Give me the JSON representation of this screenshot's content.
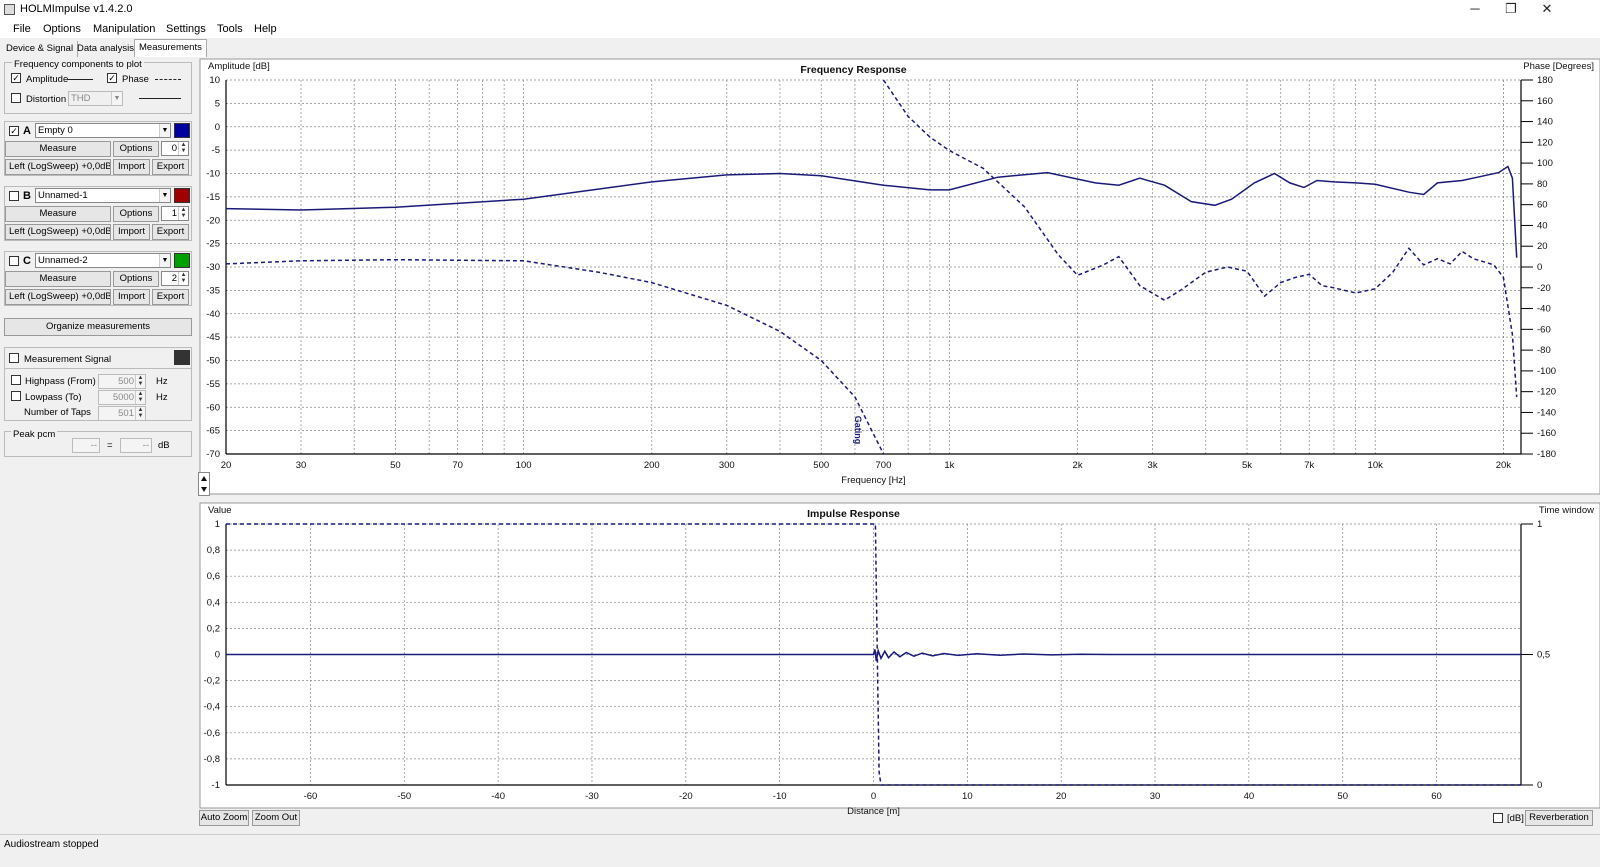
{
  "window": {
    "title": "HOLMImpulse v1.4.2.0",
    "minimize": "─",
    "restore": "❐",
    "close": "✕"
  },
  "menu": [
    "File",
    "Options",
    "Manipulation",
    "Settings",
    "Tools",
    "Help"
  ],
  "tabs": [
    "Device & Signal",
    "Data analysis",
    "Measurements"
  ],
  "freq_components": {
    "title": "Frequency components to plot",
    "amplitude": {
      "label": "Amplitude",
      "checked": true
    },
    "phase": {
      "label": "Phase",
      "checked": true
    },
    "distortion": {
      "label": "Distortion",
      "checked": false,
      "mode": "THD"
    }
  },
  "measurements": [
    {
      "letter": "A",
      "checked": true,
      "name": "Empty 0",
      "color": "#0000a0",
      "index": "0",
      "source": "Left (LogSweep) +0,0dB"
    },
    {
      "letter": "B",
      "checked": false,
      "name": "Unnamed-1",
      "color": "#a00000",
      "index": "1",
      "source": "Left (LogSweep) +0,0dB"
    },
    {
      "letter": "C",
      "checked": false,
      "name": "Unnamed-2",
      "color": "#00a000",
      "index": "2",
      "source": "Left (LogSweep) +0,0dB"
    }
  ],
  "buttons": {
    "measure": "Measure",
    "options": "Options",
    "import": "Import",
    "export": "Export",
    "organize": "Organize measurements",
    "auto_zoom": "Auto Zoom",
    "zoom_out": "Zoom Out",
    "reverberation": "Reverberation"
  },
  "measurement_signal": {
    "label": "Measurement Signal",
    "checked": false,
    "color": "#333333"
  },
  "filters": {
    "highpass": {
      "label": "Highpass (From)",
      "value": "500",
      "unit": "Hz"
    },
    "lowpass": {
      "label": "Lowpass (To)",
      "value": "5000",
      "unit": "Hz"
    },
    "taps": {
      "label": "Number of Taps",
      "value": "501"
    }
  },
  "peak": {
    "label": "Peak pcm",
    "v1": "--",
    "sep": "=",
    "v2": "--",
    "unit": "dB"
  },
  "db_toggle": {
    "label": "[dB]",
    "checked": false
  },
  "status": "Audiostream stopped",
  "chart_data": [
    {
      "type": "line",
      "title": "Frequency Response",
      "xlabel": "Frequency [Hz]",
      "ylabel": "Amplitude [dB]",
      "y2label": "Phase [Degrees]",
      "xscale": "log",
      "xlim": [
        20,
        22000
      ],
      "ylim": [
        -70,
        10
      ],
      "y2lim": [
        -180,
        180
      ],
      "xticks": [
        20,
        30,
        50,
        70,
        100,
        200,
        300,
        500,
        700,
        1000,
        2000,
        3000,
        5000,
        7000,
        10000,
        20000
      ],
      "xticklabels": [
        "20",
        "30",
        "50",
        "70",
        "100",
        "200",
        "300",
        "500",
        "700",
        "1k",
        "2k",
        "3k",
        "5k",
        "7k",
        "10k",
        "20k"
      ],
      "yticks": [
        10,
        5,
        0,
        -5,
        -10,
        -15,
        -20,
        -25,
        -30,
        -35,
        -40,
        -45,
        -50,
        -55,
        -60,
        -65,
        -70
      ],
      "y2ticks": [
        180,
        160,
        140,
        120,
        100,
        80,
        60,
        40,
        20,
        0,
        -20,
        -40,
        -60,
        -80,
        -100,
        -120,
        -140,
        -160,
        -180
      ],
      "annotation": "Gating",
      "annotation_x": 600,
      "grid": true,
      "series": [
        {
          "style": "solid",
          "axis": "left",
          "color": "#1a1a7a",
          "x": [
            20,
            30,
            50,
            100,
            200,
            300,
            400,
            500,
            700,
            900,
            1000,
            1300,
            1700,
            2200,
            2500,
            2800,
            3200,
            3700,
            4200,
            4600,
            5200,
            5800,
            6300,
            6800,
            7300,
            8000,
            9000,
            10000,
            12000,
            13000,
            14000,
            16000,
            18000,
            19500,
            20500,
            21000,
            21500
          ],
          "y": [
            -17.5,
            -17.8,
            -17.2,
            -15.5,
            -11.8,
            -10.3,
            -10.0,
            -10.5,
            -12.5,
            -13.5,
            -13.5,
            -10.8,
            -9.8,
            -12,
            -12.5,
            -11,
            -12.5,
            -16,
            -16.8,
            -15.5,
            -12,
            -10,
            -12,
            -13,
            -11.5,
            -11.8,
            -12,
            -12.3,
            -14,
            -14.5,
            -12,
            -11.5,
            -10.5,
            -9.8,
            -8.5,
            -11,
            -28
          ]
        },
        {
          "style": "dashed",
          "axis": "right",
          "color": "#1a1a7a",
          "x": [
            20,
            30,
            50,
            100,
            150,
            200,
            300,
            400,
            500,
            600,
            700
          ],
          "y": [
            3,
            6,
            7,
            6,
            -5,
            -15,
            -37,
            -62,
            -90,
            -125,
            -180
          ]
        },
        {
          "style": "dashed",
          "axis": "right",
          "color": "#1a1a7a",
          "x": [
            700,
            800,
            900,
            1000,
            1200,
            1500,
            1800,
            2000,
            2300,
            2500,
            2800,
            3200,
            3500,
            4000,
            4500,
            5000,
            5500,
            6000,
            6500,
            7000,
            7500,
            8000,
            9000,
            10000,
            11000,
            12000,
            13000,
            14000,
            15000,
            16000,
            17000,
            18000,
            19000,
            20000,
            21000,
            21500
          ],
          "y": [
            180,
            145,
            125,
            112,
            95,
            58,
            12,
            -8,
            2,
            10,
            -18,
            -32,
            -22,
            -5,
            0,
            -4,
            -28,
            -15,
            -10,
            -7,
            -18,
            -20,
            -25,
            -21,
            -5,
            18,
            2,
            8,
            3,
            15,
            8,
            5,
            2,
            -10,
            -65,
            -125
          ]
        }
      ]
    },
    {
      "type": "line",
      "title": "Impulse Response",
      "xlabel": "Distance [m]",
      "ylabel": "Value",
      "y2label": "Time window",
      "xlim": [
        -69,
        69
      ],
      "ylim": [
        -1,
        1
      ],
      "y2lim": [
        0,
        1
      ],
      "xticks": [
        -60,
        -50,
        -40,
        -30,
        -20,
        -10,
        0,
        10,
        20,
        30,
        40,
        50,
        60
      ],
      "yticks": [
        1,
        0.8,
        0.6,
        0.4,
        0.2,
        0,
        -0.2,
        -0.4,
        -0.6,
        -0.8,
        -1
      ],
      "yticklabels": [
        "1",
        "0,8",
        "0,6",
        "0,4",
        "0,2",
        "0",
        "-0,2",
        "-0,4",
        "-0,6",
        "-0,8",
        "-1"
      ],
      "y2ticks": [
        1,
        0.5,
        0
      ],
      "y2ticklabels": [
        "1",
        "0,5",
        "0"
      ],
      "grid": true,
      "series": [
        {
          "style": "solid",
          "axis": "left",
          "color": "#1a1a7a",
          "x": [
            -69,
            0,
            0.15,
            0.3,
            0.5,
            0.8,
            1.2,
            1.6,
            2.2,
            2.8,
            3.5,
            4.3,
            5.2,
            6.3,
            7.5,
            9,
            11,
            13.5,
            16,
            19,
            22,
            25,
            69
          ],
          "y": [
            0,
            0,
            0.04,
            -0.05,
            0.03,
            -0.03,
            0.025,
            -0.025,
            0.02,
            -0.018,
            0.015,
            -0.013,
            0.011,
            -0.01,
            0.008,
            -0.007,
            0.006,
            -0.005,
            0.004,
            -0.003,
            0.002,
            0,
            0
          ]
        },
        {
          "style": "dashed",
          "axis": "right",
          "color": "#1a1a7a",
          "x": [
            -69,
            0.2,
            0.4,
            0.6,
            0.8,
            69
          ],
          "y": [
            1,
            1,
            0.5,
            0.05,
            0,
            0
          ]
        }
      ]
    }
  ]
}
